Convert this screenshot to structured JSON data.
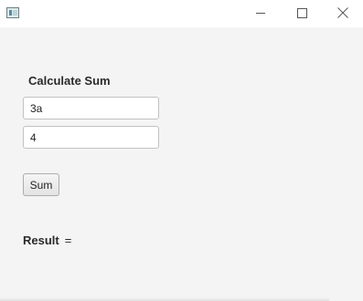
{
  "window": {
    "title": "",
    "controls": {
      "minimize_icon": "minimize-icon",
      "maximize_icon": "maximize-icon",
      "close_icon": "close-icon"
    }
  },
  "form": {
    "heading": "Calculate Sum",
    "first_value": "3a",
    "second_value": "4",
    "sum_button_label": "Sum"
  },
  "result": {
    "label": "Result",
    "equals": "=",
    "value": ""
  },
  "colors": {
    "background": "#f4f4f4",
    "titlebar": "#ffffff",
    "text": "#2a2a2a",
    "field_border": "#c2c2c2"
  }
}
